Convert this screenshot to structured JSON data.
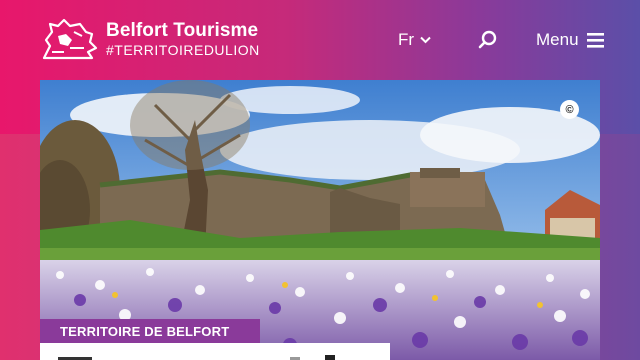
{
  "brand": {
    "name": "Belfort Tourisme",
    "tagline": "#TERRITOIREDULION",
    "logo_icon": "lion-logo-icon"
  },
  "nav": {
    "language": "Fr",
    "language_icon": "chevron-down-icon",
    "search_icon": "search-icon",
    "menu_label": "Menu",
    "menu_icon": "hamburger-icon"
  },
  "hero": {
    "copyright_symbol": "©",
    "badge": "TERRITOIRE DE BELFORT"
  },
  "colors": {
    "gradient_start": "#e8176b",
    "gradient_end": "#5b4fa8",
    "badge": "#8a3a9a"
  }
}
